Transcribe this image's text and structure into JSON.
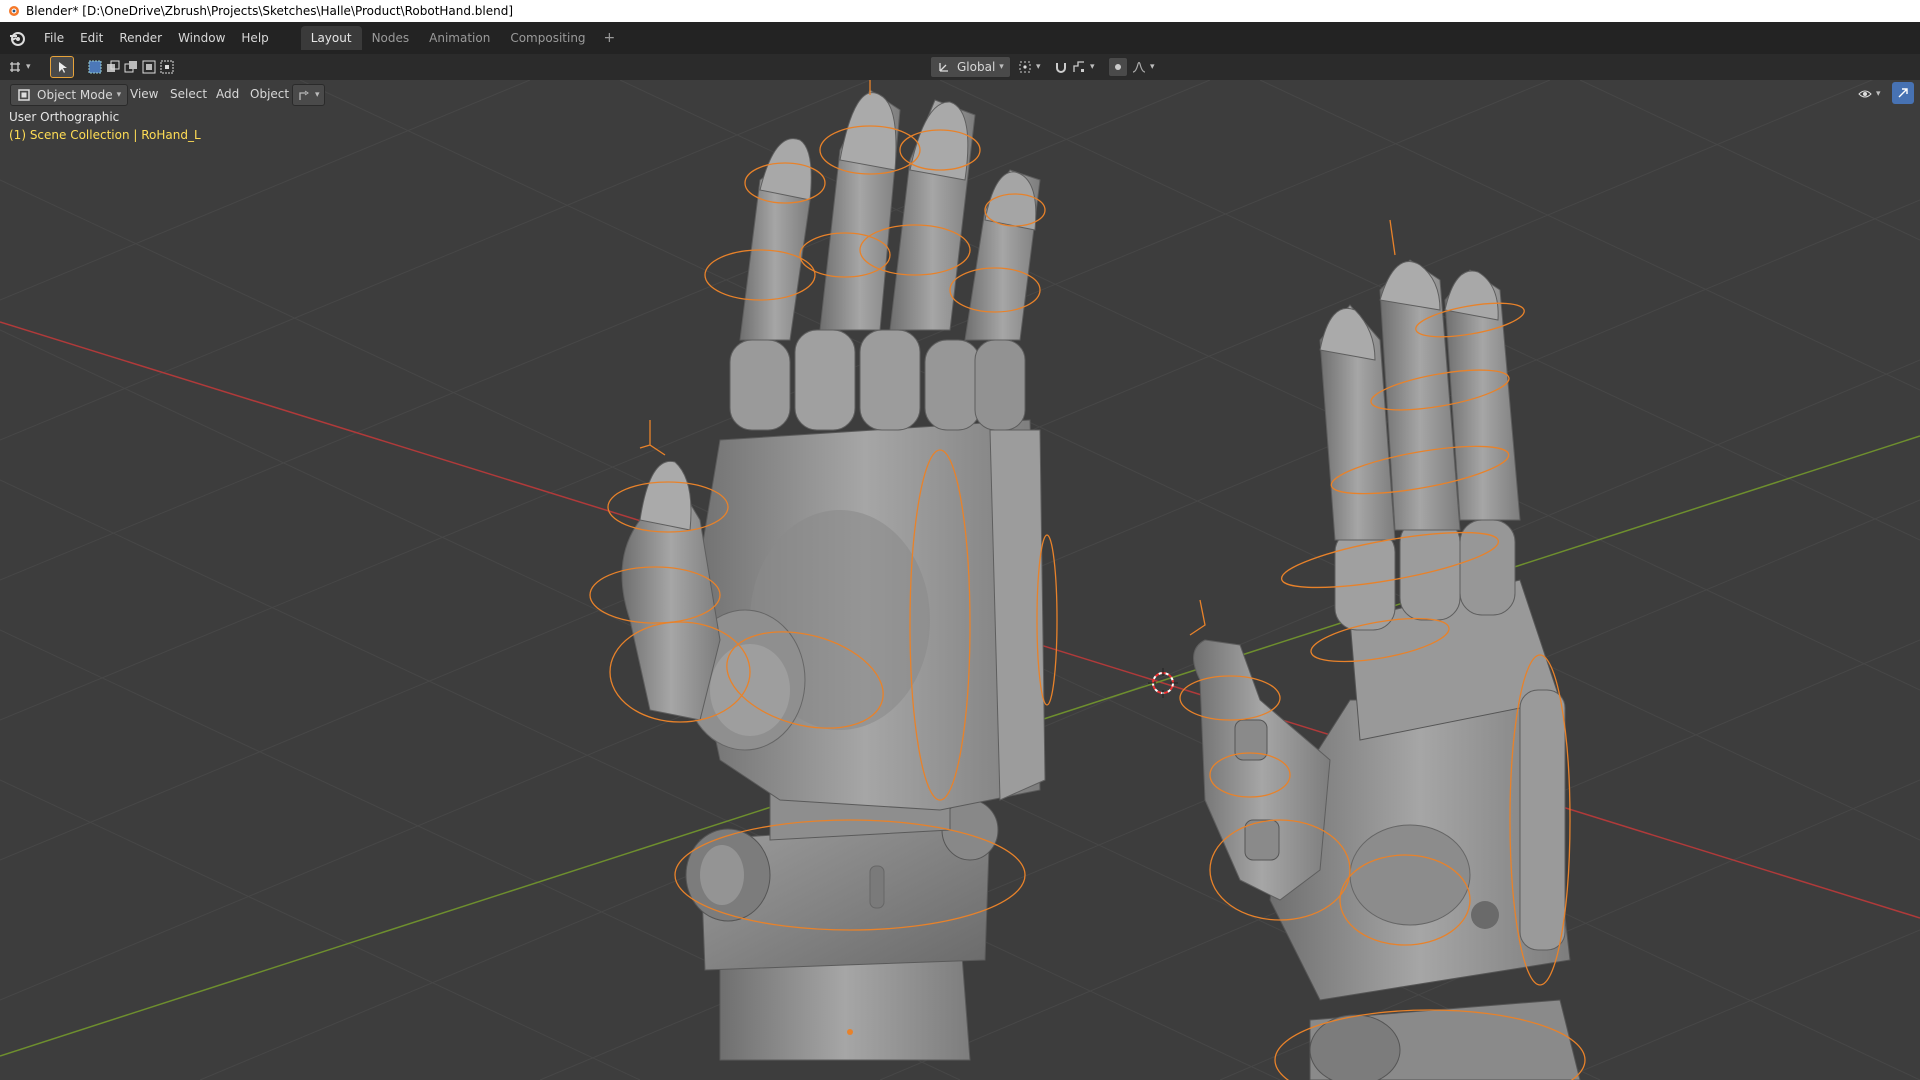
{
  "window": {
    "title": "Blender* [D:\\OneDrive\\Zbrush\\Projects\\Sketches\\Halle\\Product\\RobotHand.blend]"
  },
  "menu": {
    "items": [
      "File",
      "Edit",
      "Render",
      "Window",
      "Help"
    ]
  },
  "workspaces": {
    "tabs": [
      "Layout",
      "Nodes",
      "Animation",
      "Compositing"
    ],
    "active": "Layout",
    "add_label": "+"
  },
  "tool_header": {
    "transform_orientation": "Global"
  },
  "view_header": {
    "mode": "Object Mode",
    "menus": [
      "View",
      "Select",
      "Add",
      "Object"
    ]
  },
  "viewport": {
    "view_name": "User Orthographic",
    "collection_info": "(1) Scene Collection | RoHand_L"
  },
  "colors": {
    "viewport_bg": "#3d3d3d",
    "grid_line": "#474747",
    "x_axis": "#b03a3a",
    "y_axis": "#6e8f2e",
    "selection_orange": "#e8822a",
    "mesh_gray": "#8c8c8c",
    "info_yellow": "#ffdd55"
  },
  "icons": [
    "blender-logo-icon",
    "editor-type-icon",
    "select-box-icon",
    "pivot-icon",
    "snap-icon",
    "proportional-icon",
    "visibility-icon",
    "gizmo-icon",
    "cursor-3d-icon"
  ]
}
